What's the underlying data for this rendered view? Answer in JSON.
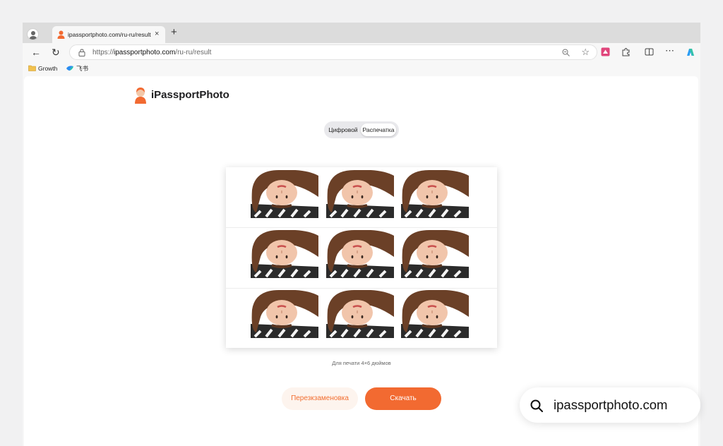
{
  "browser": {
    "tab": {
      "title": "ipassportphoto.com/ru-ru/result",
      "favicon": "ipassportphoto-favicon"
    },
    "new_tab_label": "+",
    "close_tab_label": "×",
    "address": {
      "scheme": "https://",
      "host": "ipassportphoto.com",
      "path": "/ru-ru/result"
    },
    "bookmarks": [
      {
        "label": "Growth",
        "icon": "folder-icon"
      },
      {
        "label": "飞书",
        "icon": "feishu-icon"
      }
    ]
  },
  "page": {
    "brand": "iPassportPhoto",
    "segmented": {
      "options": [
        "Цифровой",
        "Распечатка"
      ],
      "selected": "Распечатка"
    },
    "print_sheet": {
      "rows": 3,
      "columns": 3
    },
    "caption": "Для печати 4×6 дюймов",
    "buttons": {
      "retake": "Перезкзаменовка",
      "download": "Скачать"
    }
  },
  "watermark": {
    "text": "ipassportphoto.com",
    "icon": "search-icon"
  },
  "colors": {
    "accent": "#f26a31",
    "accent_soft": "#fdf4ee",
    "background": "#f1f1f2"
  }
}
